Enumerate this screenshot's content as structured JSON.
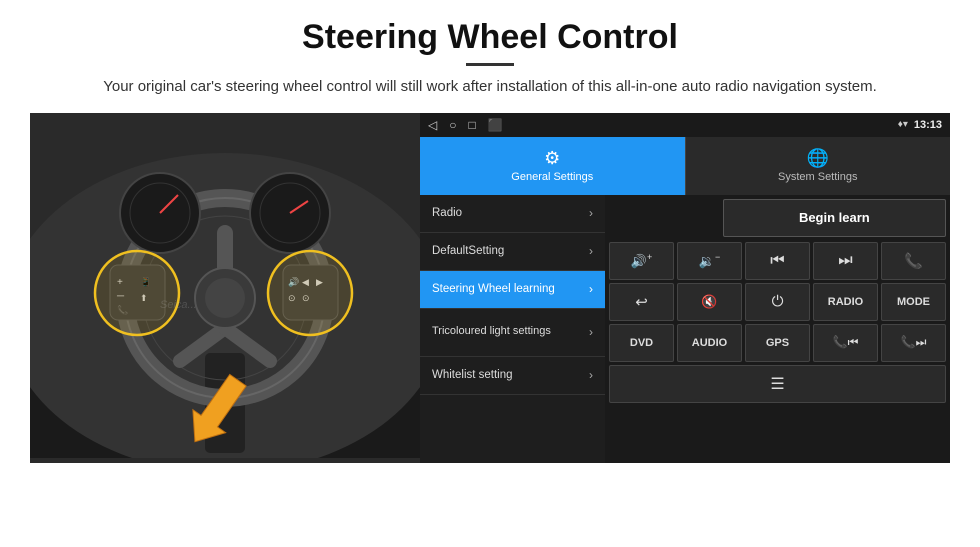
{
  "page": {
    "title": "Steering Wheel Control",
    "subtitle": "Your original car's steering wheel control will still work after installation of this all-in-one auto radio navigation system.",
    "divider": true
  },
  "status_bar": {
    "time": "13:13",
    "icons": [
      "◁",
      "○",
      "□",
      "⬛"
    ]
  },
  "tabs": [
    {
      "id": "general",
      "label": "General Settings",
      "active": true
    },
    {
      "id": "system",
      "label": "System Settings",
      "active": false
    }
  ],
  "menu_items": [
    {
      "id": "radio",
      "label": "Radio",
      "active": false
    },
    {
      "id": "default",
      "label": "DefaultSetting",
      "active": false
    },
    {
      "id": "steering",
      "label": "Steering Wheel learning",
      "active": true
    },
    {
      "id": "tricoloured",
      "label": "Tricoloured light settings",
      "active": false
    },
    {
      "id": "whitelist",
      "label": "Whitelist setting",
      "active": false
    }
  ],
  "controls": {
    "begin_learn": "Begin learn",
    "row1": [
      {
        "id": "vol-up",
        "icon": "🔊+",
        "label": "vol-up"
      },
      {
        "id": "vol-down",
        "icon": "🔉−",
        "label": "vol-down"
      },
      {
        "id": "prev",
        "icon": "⏮",
        "label": "prev"
      },
      {
        "id": "next",
        "icon": "⏭",
        "label": "next"
      },
      {
        "id": "phone",
        "icon": "📞",
        "label": "phone"
      }
    ],
    "row2": [
      {
        "id": "back",
        "icon": "↩",
        "label": "back"
      },
      {
        "id": "mute",
        "icon": "🔇",
        "label": "mute"
      },
      {
        "id": "power",
        "icon": "⏻",
        "label": "power"
      },
      {
        "id": "radio-btn",
        "icon": "RADIO",
        "label": "radio"
      },
      {
        "id": "mode",
        "icon": "MODE",
        "label": "mode"
      }
    ],
    "row3": [
      {
        "id": "dvd",
        "icon": "DVD",
        "label": "dvd"
      },
      {
        "id": "audio",
        "icon": "AUDIO",
        "label": "audio"
      },
      {
        "id": "gps",
        "icon": "GPS",
        "label": "gps"
      },
      {
        "id": "prev2",
        "icon": "📞⏮",
        "label": "prev2"
      },
      {
        "id": "next2",
        "icon": "📞⏭",
        "label": "next2"
      }
    ],
    "row4": [
      {
        "id": "list",
        "icon": "☰",
        "label": "list"
      }
    ]
  },
  "car_image": {
    "watermark": "Seica..."
  }
}
